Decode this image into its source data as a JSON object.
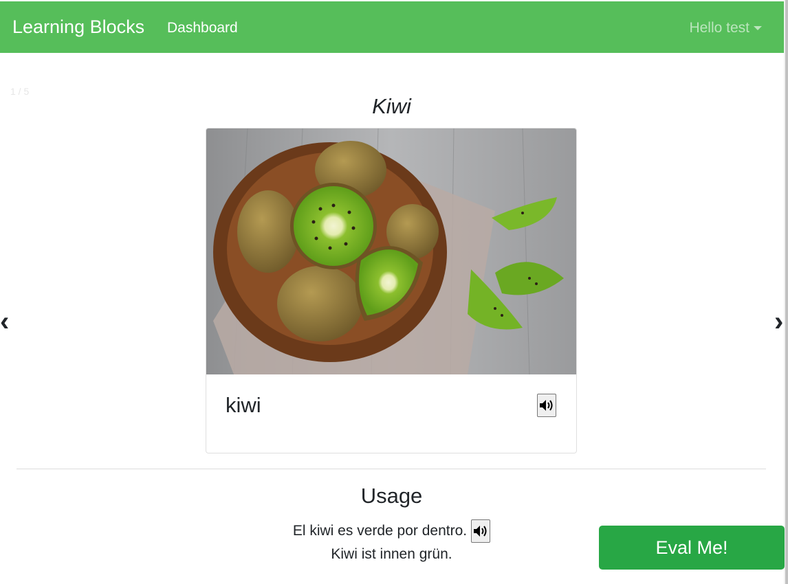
{
  "navbar": {
    "brand": "Learning Blocks",
    "dashboard_link": "Dashboard",
    "user_menu": "Hello test",
    "color": "#56be5a"
  },
  "carousel": {
    "counter": "1 / 5",
    "prev_label": "‹",
    "next_label": "›"
  },
  "card": {
    "title": "Kiwi",
    "image_alt": "kiwi",
    "word": "kiwi",
    "audio_icon": "speaker-icon"
  },
  "usage": {
    "title": "Usage",
    "example_es": "El kiwi es verde por dentro.",
    "example_de": "Kiwi ist innen grün."
  },
  "actions": {
    "eval_label": "Eval Me!",
    "eval_color": "#28a745"
  }
}
